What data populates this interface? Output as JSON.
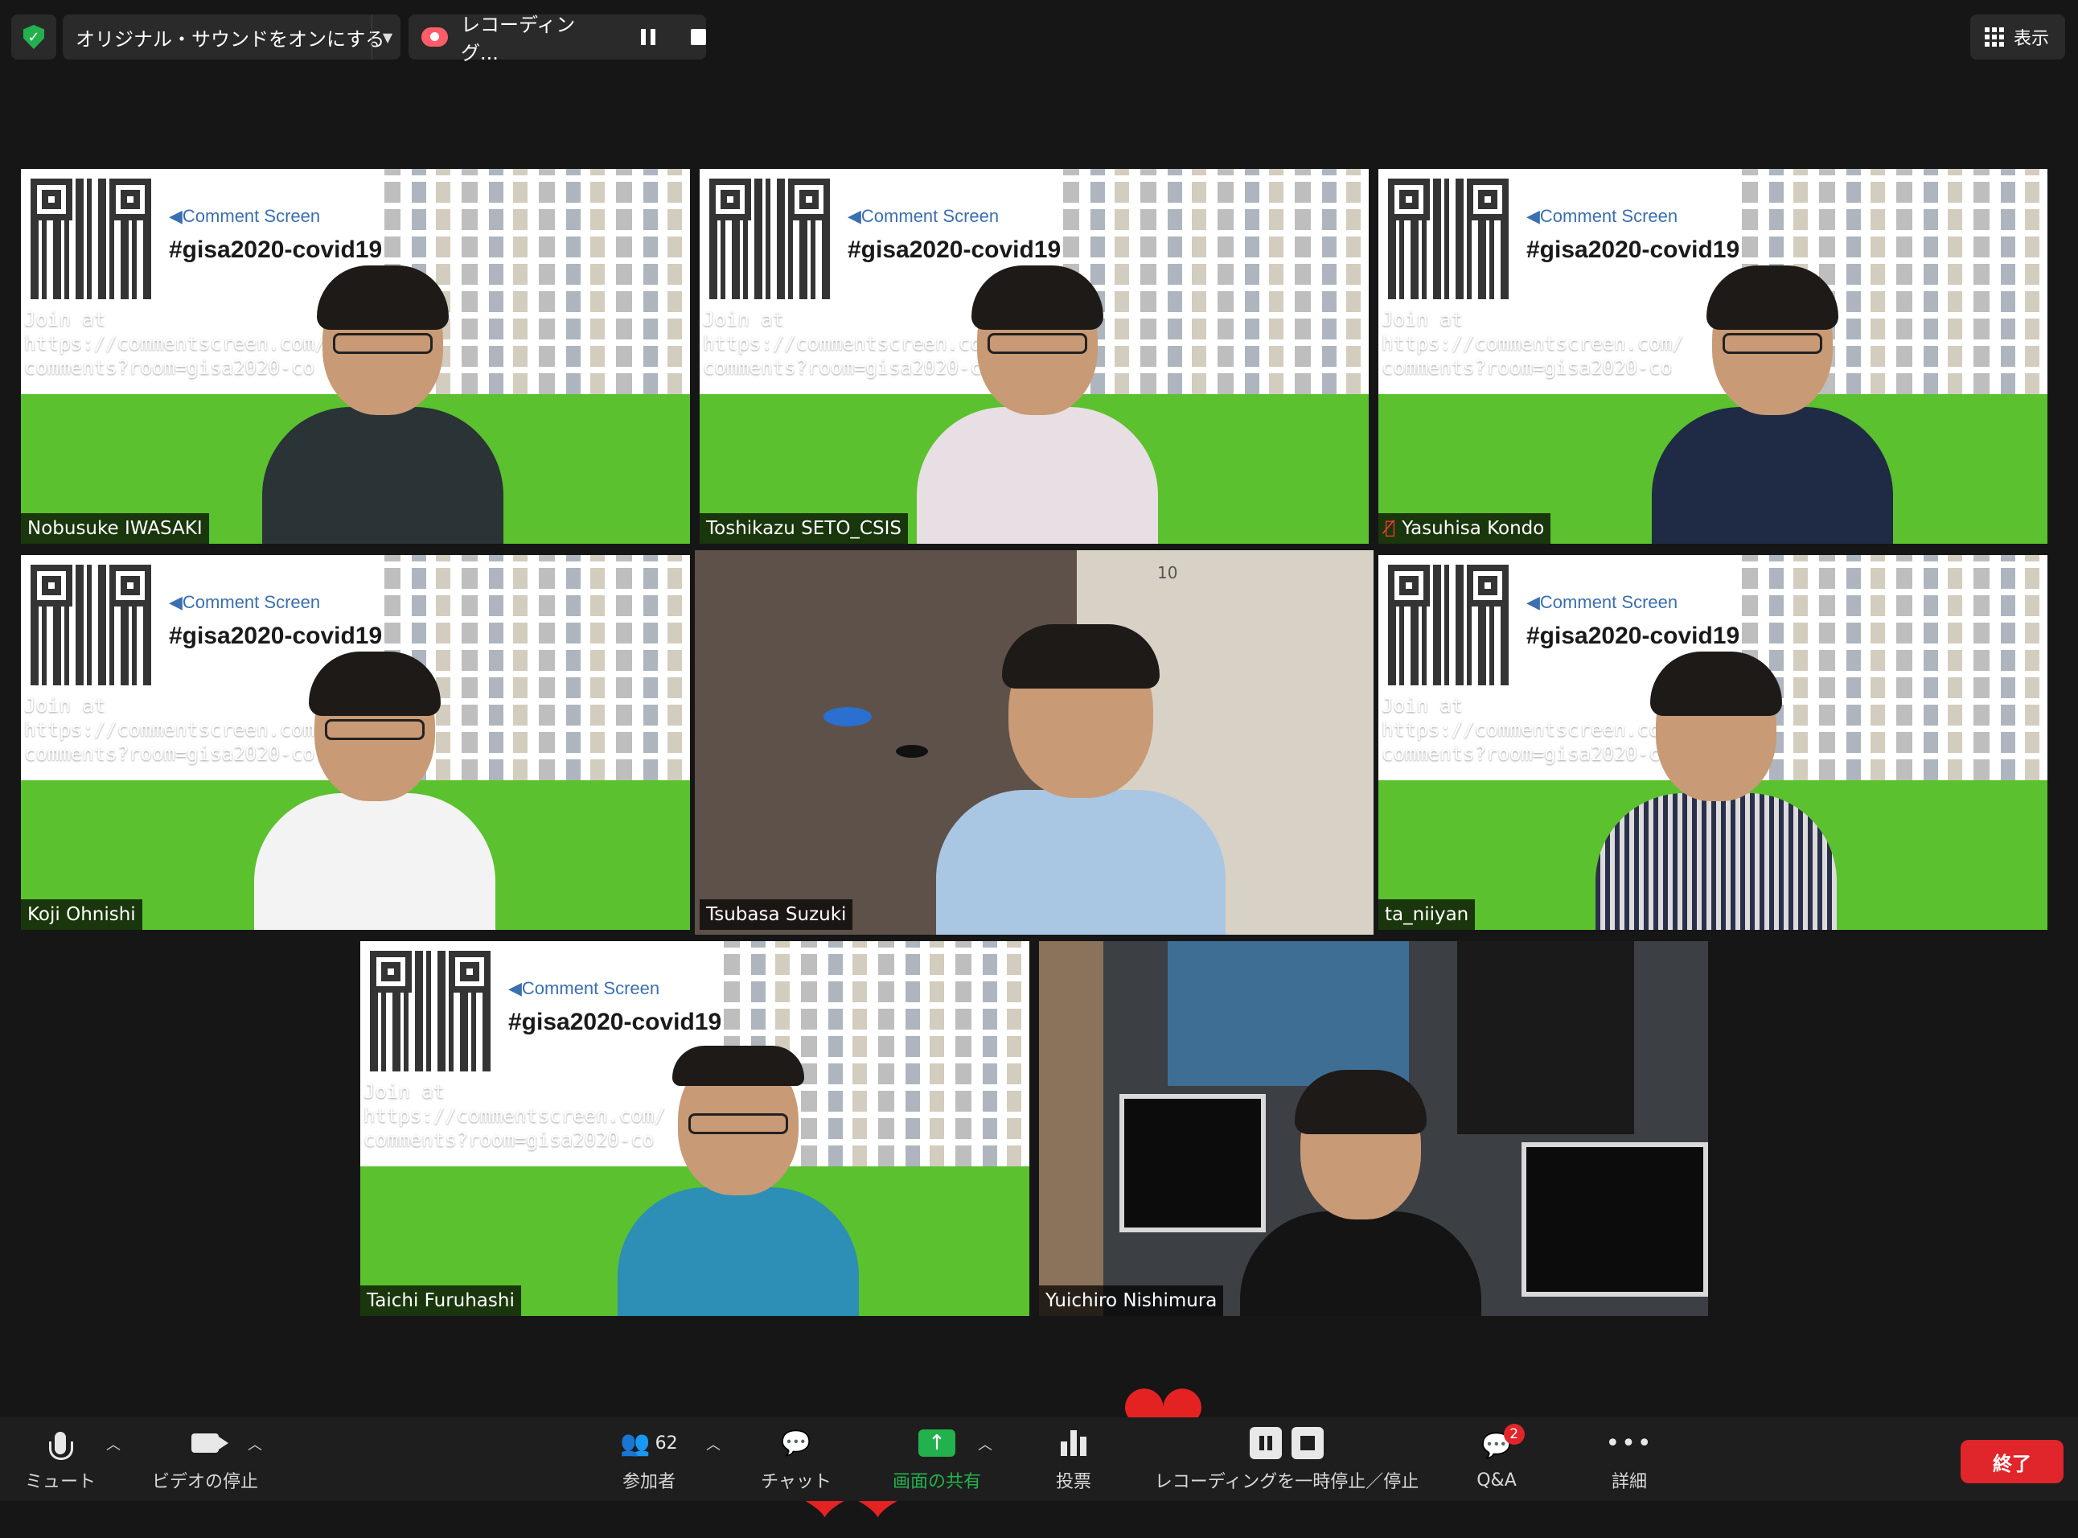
{
  "topbar": {
    "audio_label": "オリジナル・サウンドをオンにする",
    "recording_label": "レコーディング...",
    "view_label": "表示"
  },
  "tile_content": {
    "comment_screen": "◀Comment Screen",
    "hashtag": "#gisa2020-covid19",
    "join_text": "Join at\nhttps://commentscreen.com/\ncomments?room=gisa2020-co"
  },
  "participants": [
    {
      "name": "Nobusuke IWASAKI"
    },
    {
      "name": "Toshikazu SETO_CSIS"
    },
    {
      "name": "Yasuhisa Kondo",
      "muted": true
    },
    {
      "name": "Koji Ohnishi"
    },
    {
      "name": "Tsubasa Suzuki",
      "active_speaker": true
    },
    {
      "name": "ta_niiyan"
    },
    {
      "name": "Taichi Furuhashi"
    },
    {
      "name": "Yuichiro Nishimura"
    }
  ],
  "room_wall_number": "10",
  "toolbar": {
    "mute": "ミュート",
    "video_stop": "ビデオの停止",
    "participants": "参加者",
    "participants_count": "62",
    "chat": "チャット",
    "share_screen": "画面の共有",
    "polls": "投票",
    "recording": "レコーディングを一時停止／停止",
    "qa": "Q&A",
    "qa_badge": "2",
    "more": "詳細",
    "end": "終了"
  },
  "colors": {
    "background": "#161616",
    "green_screen": "#5bc12e",
    "end_button": "#e0252b",
    "active_speaker_border": "#f2f2a0",
    "share_green": "#23b14d"
  }
}
